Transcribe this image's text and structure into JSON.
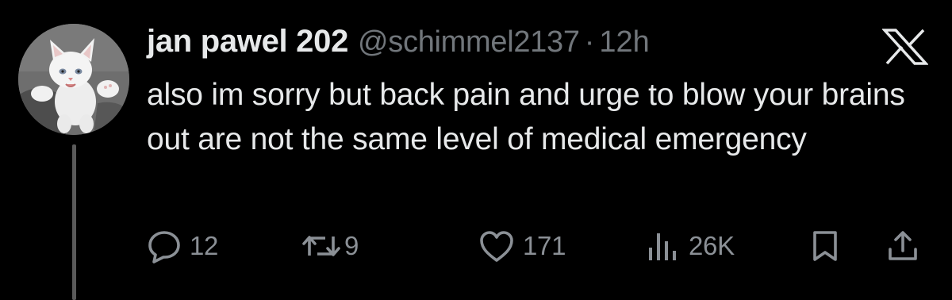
{
  "tweet": {
    "display_name": "jan pawel 202",
    "handle": "@schimmel2137",
    "separator": "·",
    "time": "12h",
    "text": "also im sorry but back pain and urge to blow your brains out are not the same level of medical emergency"
  },
  "actions": {
    "replies": "12",
    "reposts": "9",
    "likes": "171",
    "views": "26K"
  },
  "icons": {
    "logo": "x-logo-icon",
    "reply": "speech-bubble-icon",
    "repost": "repost-arrows-icon",
    "like": "heart-icon",
    "views": "bar-chart-icon",
    "bookmark": "bookmark-icon",
    "share": "share-upload-icon"
  },
  "colors": {
    "background": "#000000",
    "text_primary": "#e7e9ea",
    "text_secondary": "#71767b",
    "action_gray": "#8b9096"
  }
}
